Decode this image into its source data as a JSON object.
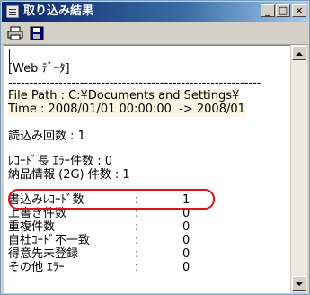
{
  "window": {
    "title": "取り込み結果",
    "min_glyph": "_",
    "max_glyph": "□",
    "close_glyph": "×"
  },
  "toolbar": {
    "buttons": [
      "print-icon",
      "save-icon"
    ]
  },
  "report": {
    "section_header": "[Web ﾃﾞｰﾀ]",
    "separator": "------------------------------------------------------------",
    "file_path": "File Path : C:¥Documents and Settings¥",
    "time_range": "Time : 2008/01/01 00:00:00  -> 2008/01",
    "read_count": "読込み回数 : 1",
    "record_length_errors": "ﾚｺｰﾄﾞ長 ｴﾗｰ件数 : 0",
    "delivery_info_count": "納品情報 (2G) 件数 : 1",
    "rows": [
      {
        "label": "書込みﾚｺｰﾄﾞ数",
        "sep": ":",
        "value": "1"
      },
      {
        "label": "上書き件数",
        "sep": ":",
        "value": "0"
      },
      {
        "label": "重複件数",
        "sep": ":",
        "value": "0"
      },
      {
        "label": "自社ｺｰﾄﾞ不一致",
        "sep": ":",
        "value": "0"
      },
      {
        "label": "得意先未登録",
        "sep": ":",
        "value": "0"
      },
      {
        "label": "その他 ｴﾗｰ",
        "sep": ":",
        "value": "0"
      }
    ]
  },
  "colors": {
    "highlight_ring": "#e01414",
    "titlebar": "#0a246a",
    "text_highlight": "#fdf5e2"
  }
}
